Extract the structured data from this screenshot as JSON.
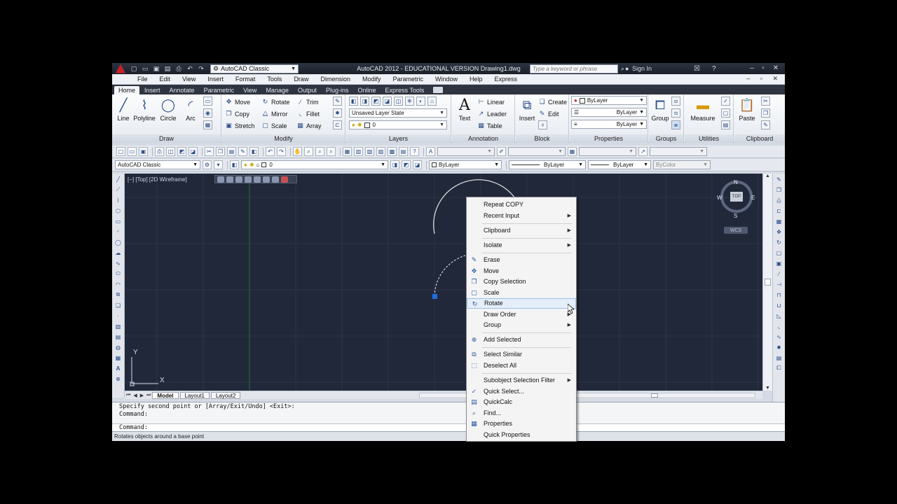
{
  "app": {
    "title": "AutoCAD 2012 - EDUCATIONAL VERSION    Drawing1.dwg",
    "workspace": "AutoCAD Classic",
    "search_placeholder": "Type a keyword or phrase",
    "sign_in": "Sign In"
  },
  "menubar": [
    "File",
    "Edit",
    "View",
    "Insert",
    "Format",
    "Tools",
    "Draw",
    "Dimension",
    "Modify",
    "Parametric",
    "Window",
    "Help",
    "Express"
  ],
  "ribbon_tabs": [
    "Home",
    "Insert",
    "Annotate",
    "Parametric",
    "View",
    "Manage",
    "Output",
    "Plug-ins",
    "Online",
    "Express Tools"
  ],
  "ribbon": {
    "draw": {
      "title": "Draw",
      "line": "Line",
      "polyline": "Polyline",
      "circle": "Circle",
      "arc": "Arc"
    },
    "modify": {
      "title": "Modify",
      "move": "Move",
      "rotate": "Rotate",
      "trim": "Trim",
      "copy": "Copy",
      "mirror": "Mirror",
      "fillet": "Fillet",
      "stretch": "Stretch",
      "scale": "Scale",
      "array": "Array"
    },
    "layers": {
      "title": "Layers",
      "layer_state": "Unsaved Layer State",
      "current_layer": "0"
    },
    "annotation": {
      "title": "Annotation",
      "text": "Text",
      "linear": "Linear",
      "leader": "Leader",
      "table": "Table"
    },
    "block": {
      "title": "Block",
      "insert": "Insert",
      "create": "Create",
      "edit": "Edit"
    },
    "properties": {
      "title": "Properties",
      "color": "ByLayer",
      "linetype": "ByLayer",
      "lineweight": "ByLayer"
    },
    "groups": {
      "title": "Groups",
      "group": "Group"
    },
    "utilities": {
      "title": "Utilities",
      "measure": "Measure"
    },
    "clipboard": {
      "title": "Clipboard",
      "paste": "Paste"
    }
  },
  "toolbar2": {
    "workspace": "AutoCAD Classic",
    "layer": "0",
    "color": "ByLayer",
    "linetype": "ByLayer",
    "lineweight": "ByLayer",
    "plotstyle": "ByColor"
  },
  "viewport": {
    "label": "[−] [Top] [2D Wireframe]",
    "viewcube": {
      "top": "TOP",
      "n": "N",
      "s": "S",
      "e": "E",
      "w": "W",
      "wcs": "WCS"
    },
    "ucs_y": "Y",
    "ucs_x": "X"
  },
  "layout_tabs": [
    "Model",
    "Layout1",
    "Layout2"
  ],
  "command": {
    "history": [
      "Specify second point or [Array/Exit/Undo] <Exit>:",
      "Command:"
    ],
    "prompt": "Command:"
  },
  "status": "Rotates objects around a base point",
  "context_menu": [
    {
      "label": "Repeat COPY",
      "icon": "",
      "submenu": false
    },
    {
      "label": "Recent Input",
      "icon": "",
      "submenu": true
    },
    {
      "label": "Clipboard",
      "icon": "",
      "submenu": true
    },
    {
      "label": "Isolate",
      "icon": "",
      "submenu": true
    },
    {
      "label": "Erase",
      "icon": "eraser-icon",
      "submenu": false
    },
    {
      "label": "Move",
      "icon": "move-icon",
      "submenu": false
    },
    {
      "label": "Copy Selection",
      "icon": "copy-icon",
      "submenu": false
    },
    {
      "label": "Scale",
      "icon": "scale-icon",
      "submenu": false
    },
    {
      "label": "Rotate",
      "icon": "rotate-icon",
      "submenu": false
    },
    {
      "label": "Draw Order",
      "icon": "",
      "submenu": true
    },
    {
      "label": "Group",
      "icon": "",
      "submenu": true
    },
    {
      "label": "Add Selected",
      "icon": "add-selected-icon",
      "submenu": false
    },
    {
      "label": "Select Similar",
      "icon": "select-similar-icon",
      "submenu": false
    },
    {
      "label": "Deselect All",
      "icon": "deselect-icon",
      "submenu": false
    },
    {
      "label": "Subobject Selection Filter",
      "icon": "",
      "submenu": true
    },
    {
      "label": "Quick Select...",
      "icon": "quick-select-icon",
      "submenu": false
    },
    {
      "label": "QuickCalc",
      "icon": "calculator-icon",
      "submenu": false
    },
    {
      "label": "Find...",
      "icon": "find-icon",
      "submenu": false
    },
    {
      "label": "Properties",
      "icon": "properties-icon",
      "submenu": false
    },
    {
      "label": "Quick Properties",
      "icon": "",
      "submenu": false
    }
  ],
  "colors": {
    "drawing_bg": "#21283a",
    "grid": "#2b3347",
    "geometry": "#e8e8e8",
    "grip": "#1e6fe0",
    "menu_hover": "#e5eef9"
  }
}
